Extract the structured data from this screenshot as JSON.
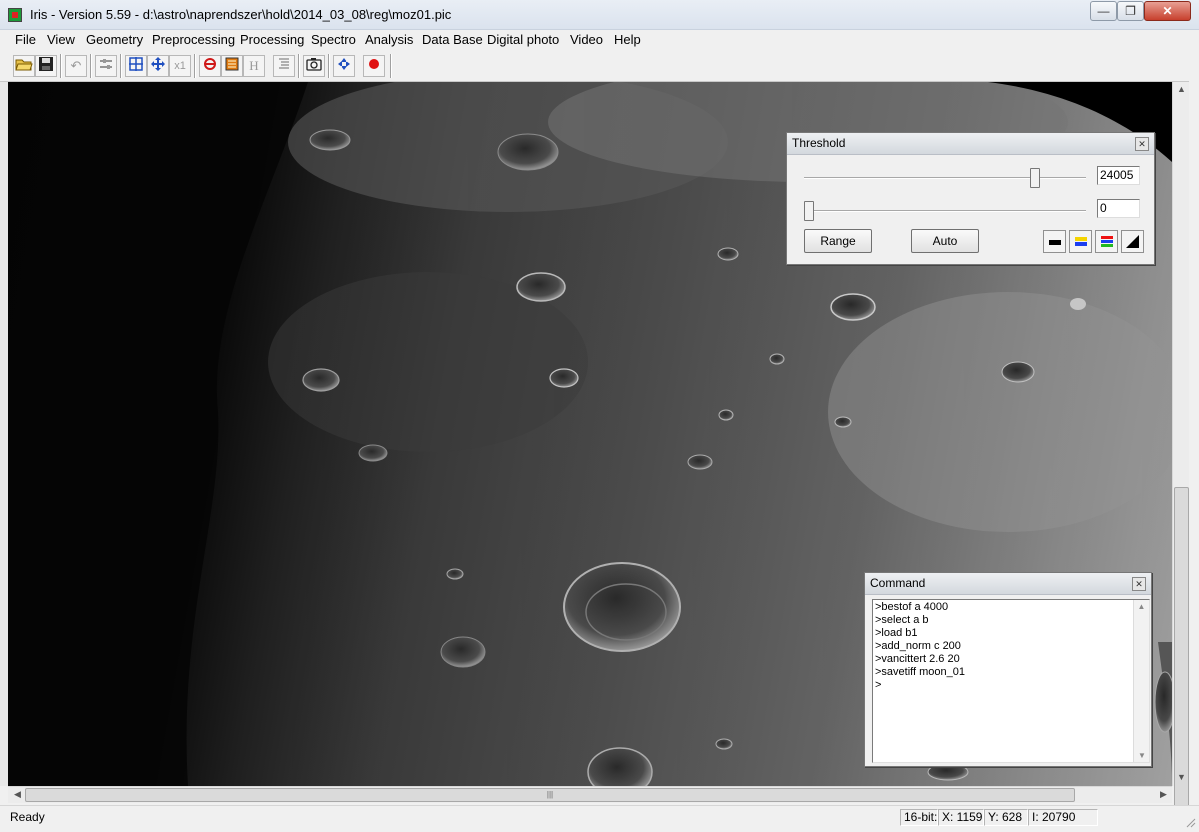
{
  "window": {
    "title": "Iris - Version 5.59 - d:\\astro\\naprendszer\\hold\\2014_03_08\\reg\\moz01.pic",
    "minimize": "—",
    "maximize": "❐",
    "close": "✕"
  },
  "menu": [
    "File",
    "View",
    "Geometry",
    "Preprocessing",
    "Processing",
    "Spectro",
    "Analysis",
    "Data Base",
    "Digital photo",
    "Video",
    "Help"
  ],
  "toolbar": {
    "undo_icon": "↶",
    "x1_label": "x1",
    "h_label": "H"
  },
  "threshold": {
    "title": "Threshold",
    "high_value": "24005",
    "low_value": "0",
    "high_level": 0.83,
    "low_level": 0.0,
    "range_label": "Range",
    "auto_label": "Auto"
  },
  "command": {
    "title": "Command",
    "lines": [
      ">bestof a 4000",
      ">select a b",
      ">load b1",
      ">add_norm c 200",
      ">vancittert 2.6 20",
      ">savetiff moon_01",
      ">"
    ]
  },
  "status": {
    "text": "Ready",
    "depth": "16-bit:",
    "x": "X: 1159",
    "y": "Y: 628",
    "i": "I: 20790"
  },
  "scroll": {
    "h_grip": "|||"
  },
  "colors": {
    "titlebar": "#dbe3ee",
    "close_button": "#c7402d"
  }
}
